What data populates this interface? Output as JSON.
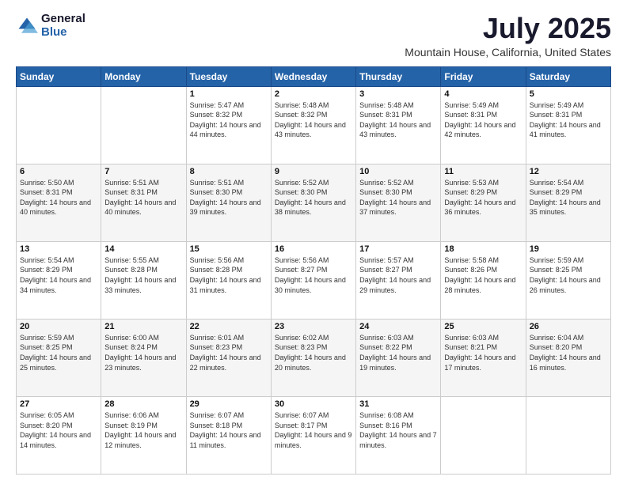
{
  "logo": {
    "general": "General",
    "blue": "Blue"
  },
  "header": {
    "month": "July 2025",
    "location": "Mountain House, California, United States"
  },
  "days_of_week": [
    "Sunday",
    "Monday",
    "Tuesday",
    "Wednesday",
    "Thursday",
    "Friday",
    "Saturday"
  ],
  "weeks": [
    [
      {
        "day": "",
        "info": ""
      },
      {
        "day": "",
        "info": ""
      },
      {
        "day": "1",
        "info": "Sunrise: 5:47 AM\nSunset: 8:32 PM\nDaylight: 14 hours and 44 minutes."
      },
      {
        "day": "2",
        "info": "Sunrise: 5:48 AM\nSunset: 8:32 PM\nDaylight: 14 hours and 43 minutes."
      },
      {
        "day": "3",
        "info": "Sunrise: 5:48 AM\nSunset: 8:31 PM\nDaylight: 14 hours and 43 minutes."
      },
      {
        "day": "4",
        "info": "Sunrise: 5:49 AM\nSunset: 8:31 PM\nDaylight: 14 hours and 42 minutes."
      },
      {
        "day": "5",
        "info": "Sunrise: 5:49 AM\nSunset: 8:31 PM\nDaylight: 14 hours and 41 minutes."
      }
    ],
    [
      {
        "day": "6",
        "info": "Sunrise: 5:50 AM\nSunset: 8:31 PM\nDaylight: 14 hours and 40 minutes."
      },
      {
        "day": "7",
        "info": "Sunrise: 5:51 AM\nSunset: 8:31 PM\nDaylight: 14 hours and 40 minutes."
      },
      {
        "day": "8",
        "info": "Sunrise: 5:51 AM\nSunset: 8:30 PM\nDaylight: 14 hours and 39 minutes."
      },
      {
        "day": "9",
        "info": "Sunrise: 5:52 AM\nSunset: 8:30 PM\nDaylight: 14 hours and 38 minutes."
      },
      {
        "day": "10",
        "info": "Sunrise: 5:52 AM\nSunset: 8:30 PM\nDaylight: 14 hours and 37 minutes."
      },
      {
        "day": "11",
        "info": "Sunrise: 5:53 AM\nSunset: 8:29 PM\nDaylight: 14 hours and 36 minutes."
      },
      {
        "day": "12",
        "info": "Sunrise: 5:54 AM\nSunset: 8:29 PM\nDaylight: 14 hours and 35 minutes."
      }
    ],
    [
      {
        "day": "13",
        "info": "Sunrise: 5:54 AM\nSunset: 8:29 PM\nDaylight: 14 hours and 34 minutes."
      },
      {
        "day": "14",
        "info": "Sunrise: 5:55 AM\nSunset: 8:28 PM\nDaylight: 14 hours and 33 minutes."
      },
      {
        "day": "15",
        "info": "Sunrise: 5:56 AM\nSunset: 8:28 PM\nDaylight: 14 hours and 31 minutes."
      },
      {
        "day": "16",
        "info": "Sunrise: 5:56 AM\nSunset: 8:27 PM\nDaylight: 14 hours and 30 minutes."
      },
      {
        "day": "17",
        "info": "Sunrise: 5:57 AM\nSunset: 8:27 PM\nDaylight: 14 hours and 29 minutes."
      },
      {
        "day": "18",
        "info": "Sunrise: 5:58 AM\nSunset: 8:26 PM\nDaylight: 14 hours and 28 minutes."
      },
      {
        "day": "19",
        "info": "Sunrise: 5:59 AM\nSunset: 8:25 PM\nDaylight: 14 hours and 26 minutes."
      }
    ],
    [
      {
        "day": "20",
        "info": "Sunrise: 5:59 AM\nSunset: 8:25 PM\nDaylight: 14 hours and 25 minutes."
      },
      {
        "day": "21",
        "info": "Sunrise: 6:00 AM\nSunset: 8:24 PM\nDaylight: 14 hours and 23 minutes."
      },
      {
        "day": "22",
        "info": "Sunrise: 6:01 AM\nSunset: 8:23 PM\nDaylight: 14 hours and 22 minutes."
      },
      {
        "day": "23",
        "info": "Sunrise: 6:02 AM\nSunset: 8:23 PM\nDaylight: 14 hours and 20 minutes."
      },
      {
        "day": "24",
        "info": "Sunrise: 6:03 AM\nSunset: 8:22 PM\nDaylight: 14 hours and 19 minutes."
      },
      {
        "day": "25",
        "info": "Sunrise: 6:03 AM\nSunset: 8:21 PM\nDaylight: 14 hours and 17 minutes."
      },
      {
        "day": "26",
        "info": "Sunrise: 6:04 AM\nSunset: 8:20 PM\nDaylight: 14 hours and 16 minutes."
      }
    ],
    [
      {
        "day": "27",
        "info": "Sunrise: 6:05 AM\nSunset: 8:20 PM\nDaylight: 14 hours and 14 minutes."
      },
      {
        "day": "28",
        "info": "Sunrise: 6:06 AM\nSunset: 8:19 PM\nDaylight: 14 hours and 12 minutes."
      },
      {
        "day": "29",
        "info": "Sunrise: 6:07 AM\nSunset: 8:18 PM\nDaylight: 14 hours and 11 minutes."
      },
      {
        "day": "30",
        "info": "Sunrise: 6:07 AM\nSunset: 8:17 PM\nDaylight: 14 hours and 9 minutes."
      },
      {
        "day": "31",
        "info": "Sunrise: 6:08 AM\nSunset: 8:16 PM\nDaylight: 14 hours and 7 minutes."
      },
      {
        "day": "",
        "info": ""
      },
      {
        "day": "",
        "info": ""
      }
    ]
  ]
}
